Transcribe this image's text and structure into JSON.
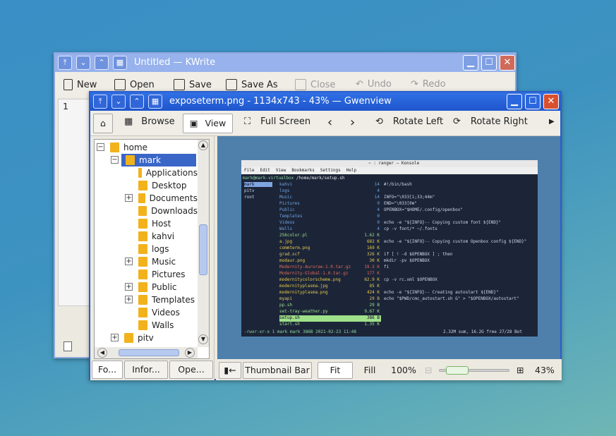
{
  "kwrite": {
    "title": "Untitled — KWrite",
    "toolbar": {
      "new": "New",
      "open": "Open",
      "save": "Save",
      "save_as": "Save As",
      "close": "Close",
      "undo": "Undo",
      "redo": "Redo"
    },
    "line_number": "1"
  },
  "gwenview": {
    "title": "exposeterm.png - 1134x743 - 43% — Gwenview",
    "toolbar": {
      "browse": "Browse",
      "view": "View",
      "full_screen": "Full Screen",
      "rotate_left": "Rotate Left",
      "rotate_right": "Rotate Right"
    },
    "tree": [
      {
        "label": "home"
      },
      {
        "label": "mark"
      },
      {
        "label": "Applications"
      },
      {
        "label": "Desktop"
      },
      {
        "label": "Documents"
      },
      {
        "label": "Downloads"
      },
      {
        "label": "Host"
      },
      {
        "label": "kahvi"
      },
      {
        "label": "logs"
      },
      {
        "label": "Music"
      },
      {
        "label": "Pictures"
      },
      {
        "label": "Public"
      },
      {
        "label": "Templates"
      },
      {
        "label": "Videos"
      },
      {
        "label": "Walls"
      },
      {
        "label": "pitv"
      }
    ],
    "side_tabs": [
      "Fo...",
      "Infor...",
      "Ope..."
    ],
    "status": {
      "thumbnail_bar": "Thumbnail Bar",
      "fit": "Fit",
      "fill": "Fill",
      "zoom_100": "100%",
      "zoom_value": "43%",
      "zoom_level": 0.25
    },
    "image": {
      "window_title": "~ : ranger — Konsole",
      "menu": [
        "File",
        "Edit",
        "View",
        "Bookmarks",
        "Settings",
        "Help"
      ],
      "path_user": "mark@mark-virtualbox",
      "path": "/home/mark/setup.sh",
      "left_col": [
        "mark",
        "pitv",
        "root"
      ],
      "files": [
        [
          "kahvi",
          "14"
        ],
        [
          "logs",
          "4"
        ],
        [
          "Music",
          "14"
        ],
        [
          "Pictures",
          "9"
        ],
        [
          "Public",
          "4"
        ],
        [
          "Templates",
          "0"
        ],
        [
          "Videos",
          "0"
        ],
        [
          "Walls",
          "4"
        ],
        [
          "256color.pl",
          "1.62 K"
        ],
        [
          "a.jpg",
          "682 K"
        ],
        [
          "commterm.png",
          "169 K"
        ],
        [
          "grad.xcf",
          "326 K"
        ],
        [
          "modaur.png",
          "30 K"
        ],
        [
          "Modernity-Aurorae-1.0.tar.gz",
          "19.3 K"
        ],
        [
          "Modernity-Global-1.0.tar.gz",
          "177 K"
        ],
        [
          "modernitycolorscheme.png",
          "62.9 K"
        ],
        [
          "modernityplasma.jpg",
          "85 K"
        ],
        [
          "modernityplasma.png",
          "424 K"
        ],
        [
          "myapi",
          "29 B"
        ],
        [
          "pp.sh",
          "29 B"
        ],
        [
          "set-tray-weather.py",
          "9.67 K"
        ],
        [
          "setup.sh",
          "386 B"
        ],
        [
          "start.sh",
          "1.35 K"
        ]
      ],
      "script": [
        "#!/bin/bash",
        "",
        "INFO=\"\\033[1;33;44m\"",
        "END=\"\\033[0m\"",
        "OPENBOX=\"$HOME/.config/openbox\"",
        "",
        "echo -e \"${INFO}-- Copying custom font ${END}\"",
        "cp -v font/* ~/.fonts",
        "",
        "echo -e \"${INFO}-- Copying custom Openbox config ${END}\"",
        "",
        "if [ ! -d $OPENBOX ] ; then",
        "  mkdir -pv $OPENBOX",
        "fi",
        "",
        "cp -v rc.xml $OPENBOX",
        "",
        "echo -e \"${INFO}-- Creating autostart ${END}\"",
        "echo \"$PWD/cmc_autostart.sh &\" > \"$OPENBOX/autostart\""
      ],
      "status_left": "-rwxr-xr-x 1 mark mark 386B 2021-02-23 11:48",
      "status_right": "2.32M sum, 16.2G free  27/28  Bot"
    }
  },
  "colors": {
    "titlebar": "#2a62d8",
    "selection": "#3a66c8",
    "terminal_bg": "#1c2538"
  }
}
